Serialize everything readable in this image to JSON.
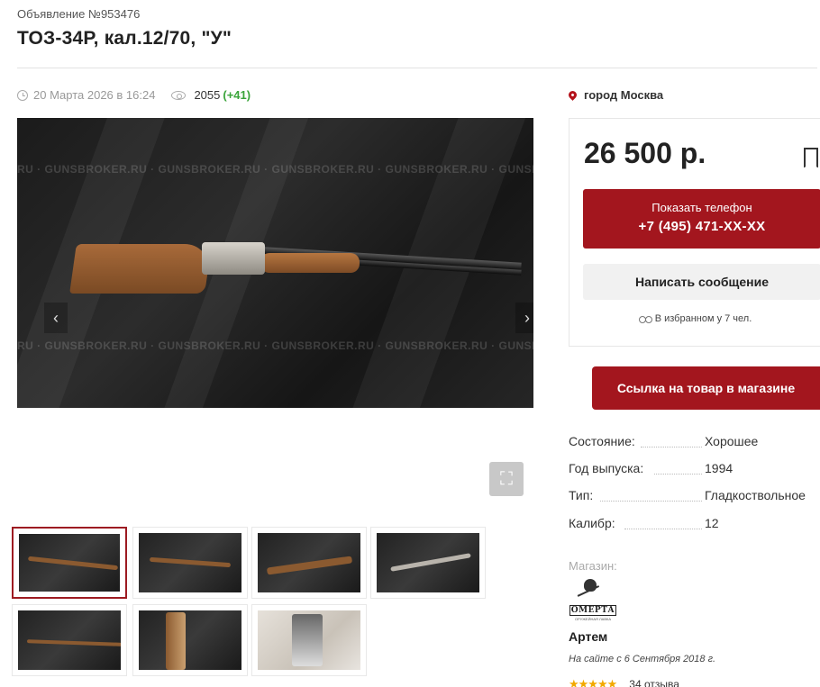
{
  "listing": {
    "ad_number": "Объявление №953476",
    "title": "ТОЗ-34Р, кал.12/70, \"У\"",
    "date": "20 Марта 2026 в 16:24",
    "views": "2055",
    "views_delta": "(+41)",
    "location": "город Москва"
  },
  "gallery": {
    "watermark": "RU · GUNSBROKER.RU · GUNSBROKER.RU · GUNSBROKER.RU · GUNSBROKER.RU · GUNSBROKER.RU",
    "prev_arrow": "‹",
    "next_arrow": "›",
    "expand_glyph": "⛶",
    "thumbnail_count": 7,
    "active_thumbnail": 1
  },
  "purchase": {
    "price": "26 500 р.",
    "show_phone_label": "Показать телефон",
    "phone": "+7 (495) 471-XX-XX",
    "message_label": "Написать сообщение",
    "favorites": "В избранном у 7 чел.",
    "shop_link_label": "Ссылка на товар в магазине"
  },
  "specs": [
    {
      "key": "Состояние:",
      "value": "Хорошее"
    },
    {
      "key": "Год выпуска:",
      "value": "1994"
    },
    {
      "key": "Тип:",
      "value": "Гладкоствольное"
    },
    {
      "key": "Калибр:",
      "value": "12"
    }
  ],
  "shop": {
    "label": "Магазин:",
    "logo_name": "ОМЕРТА",
    "logo_sub": "ОРУЖЕЙНАЯ ЛАВКА",
    "seller": "Артем",
    "since": "На сайте с 6 Сентября 2018 г.",
    "stars": "★★★★★",
    "rating_value": 5,
    "reviews": "34 отзыва"
  },
  "colors": {
    "accent": "#a3161e",
    "active_thumb_border": "#9d1b22",
    "views_delta": "#3aa43a",
    "stars": "#f2a900"
  },
  "icons": [
    "clock-icon",
    "eye-icon",
    "location-pin-icon",
    "bookmark-icon",
    "binoculars-icon",
    "expand-icon",
    "chevron-left-icon",
    "chevron-right-icon"
  ]
}
